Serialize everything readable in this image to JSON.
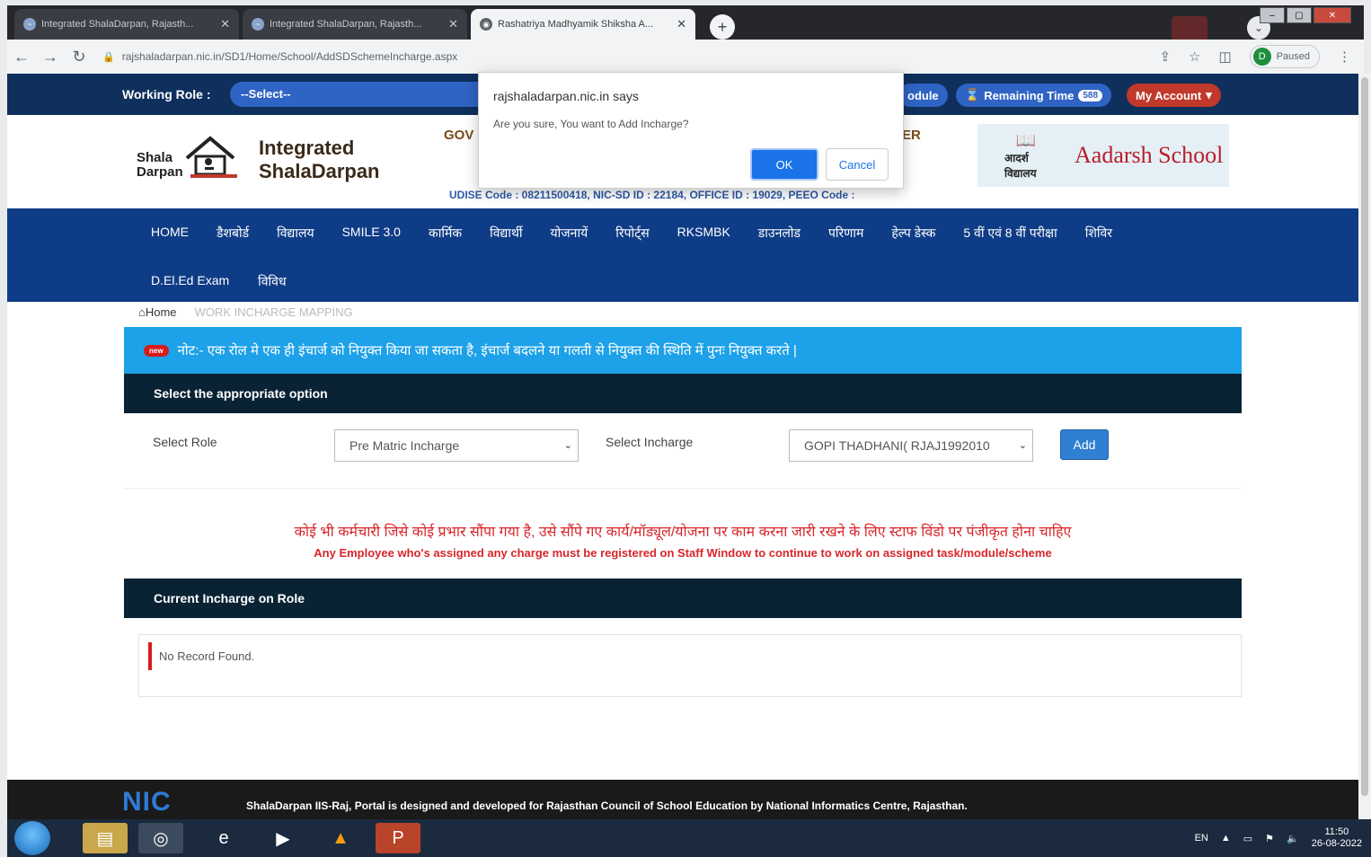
{
  "browser": {
    "tabs": [
      {
        "title": "Integrated ShalaDarpan, Rajasth..."
      },
      {
        "title": "Integrated ShalaDarpan, Rajasth..."
      },
      {
        "title": "Rashatriya Madhyamik Shiksha A..."
      }
    ],
    "url": "rajshaladarpan.nic.in/SD1/Home/School/AddSDSchemeIncharge.aspx",
    "profile_initial": "D",
    "profile_status": "Paused"
  },
  "rolebar": {
    "working_role_label": "Working Role :",
    "role_value": "--Select--",
    "module_label": "odule",
    "remaining_time_label": "Remaining Time",
    "remaining_time_value": "588",
    "my_account_label": "My Account"
  },
  "header": {
    "logo_line1": "Shala",
    "logo_line2": "Darpan",
    "brand_line1": "Integrated",
    "brand_line2": "ShalaDarpan",
    "gov_left": "GOV",
    "gov_right": "ER",
    "udise_text": "UDISE Code : 08211500418, NIC-SD ID : 22184, OFFICE ID : 19029, PEEO Code :",
    "aadarsh_emblem_text": "आदर्श विद्यालय",
    "aadarsh_title": "Aadarsh School"
  },
  "nav": {
    "row1": [
      "HOME",
      "डैशबोर्ड",
      "विद्यालय",
      "SMILE 3.0",
      "कार्मिक",
      "विद्यार्थी",
      "योजनायें",
      "रिपोर्ट्स",
      "RKSMBK",
      "डाउनलोड",
      "परिणाम",
      "हेल्प डेस्क",
      "5 वीं एवं 8 वीं परीक्षा",
      "शिविर"
    ],
    "row2": [
      "D.El.Ed Exam",
      "विविध"
    ]
  },
  "breadcrumb": {
    "home": "Home",
    "current": "WORK INCHARGE MAPPING"
  },
  "notice": {
    "badge": "new",
    "text": "नोट:- एक रोल मे एक ही इंचार्ज को नियुक्त किया जा सकता है, इंचार्ज बदलने या गलती से नियुक्त की स्थिति में पुनः नियुक्त करते |"
  },
  "form": {
    "section_title": "Select the appropriate option",
    "select_role_label": "Select Role",
    "select_role_value": "Pre Matric Incharge",
    "select_incharge_label": "Select Incharge",
    "select_incharge_value": "GOPI THADHANI( RJAJ1992010",
    "add_label": "Add"
  },
  "warning": {
    "hindi": "कोई भी कर्मचारी जिसे कोई प्रभार सौंपा गया है, उसे सौंपे गए कार्य/मॉड्यूल/योजना पर काम करना जारी रखने के लिए स्टाफ विंडो पर पंजीकृत होना चाहिए",
    "english": "Any Employee who's assigned any charge must be registered on Staff Window to continue to work on assigned task/module/scheme"
  },
  "current": {
    "section_title": "Current Incharge on Role",
    "empty_message": "No Record Found."
  },
  "footer": {
    "logo": "NIC",
    "text": "ShalaDarpan IIS-Raj, Portal is designed and developed for Rajasthan Council of School Education by National Informatics Centre, Rajasthan."
  },
  "dialog": {
    "title": "rajshaladarpan.nic.in says",
    "message": "Are you sure, You want to Add Incharge?",
    "ok_label": "OK",
    "cancel_label": "Cancel"
  },
  "taskbar": {
    "language": "EN",
    "time": "11:50",
    "date": "26-08-2022"
  },
  "colors": {
    "navy": "#0f2f5c",
    "nav_blue": "#0f3c86",
    "notice_blue": "#1da1e8",
    "section_dark": "#0a2334",
    "warning_red": "#d8262b",
    "add_button": "#2f7fd2",
    "account_red": "#c0392b"
  }
}
